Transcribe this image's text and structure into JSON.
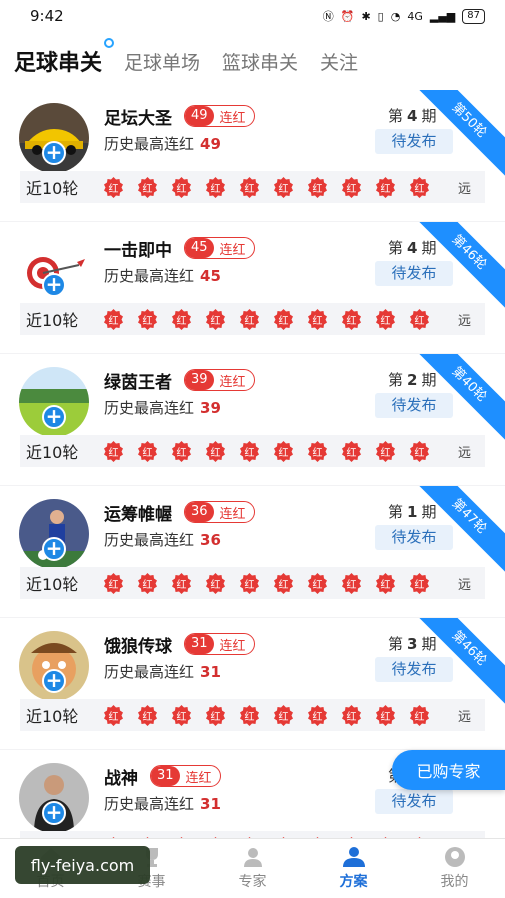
{
  "status": {
    "time": "9:42",
    "battery": "87",
    "signal": "4G"
  },
  "tabs": [
    {
      "label": "足球串关"
    },
    {
      "label": "足球单场"
    },
    {
      "label": "篮球串关"
    },
    {
      "label": "关注"
    }
  ],
  "card_common": {
    "history_label": "历史最高连红",
    "streak_label": "连红",
    "period_prefix": "第",
    "period_suffix": "期",
    "pending_label": "待发布",
    "recent_label": "近10轮",
    "badge_text": "红",
    "far_label": "远"
  },
  "experts": [
    {
      "name": "足坛大圣",
      "streak": "49",
      "history": "49",
      "period": "4",
      "ribbon": "第50轮",
      "avatar": "car"
    },
    {
      "name": "一击即中",
      "streak": "45",
      "history": "45",
      "period": "4",
      "ribbon": "第46轮",
      "avatar": "dart"
    },
    {
      "name": "绿茵王者",
      "streak": "39",
      "history": "39",
      "period": "2",
      "ribbon": "第40轮",
      "avatar": "field"
    },
    {
      "name": "运筹帷幄",
      "streak": "36",
      "history": "36",
      "period": "1",
      "ribbon": "第47轮",
      "avatar": "player"
    },
    {
      "name": "饿狼传球",
      "streak": "31",
      "history": "31",
      "period": "3",
      "ribbon": "第46轮",
      "avatar": "cartoon"
    },
    {
      "name": "战神",
      "streak": "31",
      "history": "31",
      "period": "3",
      "ribbon": "",
      "avatar": "person"
    }
  ],
  "float_button": "已购专家",
  "watermark": "fly-feiya.com",
  "bottom_nav": [
    {
      "label": "首页",
      "icon": "home-icon"
    },
    {
      "label": "赛事",
      "icon": "trophy-icon"
    },
    {
      "label": "专家",
      "icon": "expert-icon"
    },
    {
      "label": "方案",
      "icon": "plan-icon",
      "active": true
    },
    {
      "label": "我的",
      "icon": "profile-icon"
    }
  ],
  "colors": {
    "accent": "#1e8fff",
    "red": "#e53935"
  }
}
